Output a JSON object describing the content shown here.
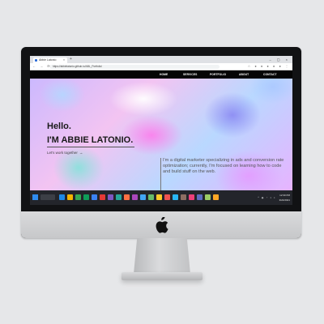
{
  "browser": {
    "tab_title": "Abbie Latonio",
    "url": "https://abbielatonio.github.io/ABL_Portfolio/"
  },
  "site": {
    "nav": [
      "HOME",
      "SERVICES",
      "PORTFOLIO",
      "ABOUT",
      "CONTACT"
    ],
    "greeting": "Hello.",
    "name": "I'M ABBIE LATONIO.",
    "cta": "Let's work together",
    "cta_arrow": "→",
    "bio": "I'm a digital marketer specializing in ads and conversion rate optimization; currently, I'm focused on learning how to code and build stuff on the web."
  },
  "taskbar": {
    "time": "12:30 PM",
    "date": "3/24/2021"
  },
  "colors": {
    "nav_bg": "#050505",
    "taskbar_bg": "#23252b",
    "bezel": "#111214",
    "aluminum": "#d0d1d3"
  }
}
